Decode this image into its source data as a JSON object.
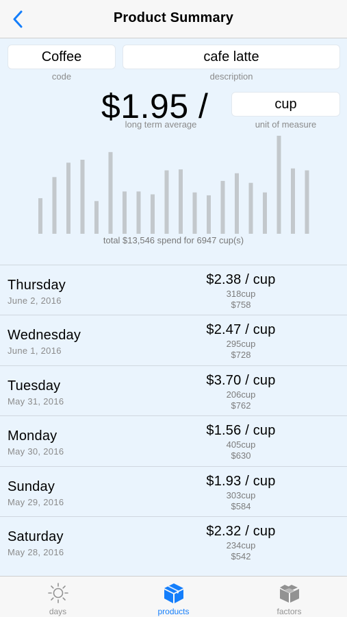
{
  "nav": {
    "title": "Product Summary"
  },
  "product": {
    "code": "Coffee",
    "code_caption": "code",
    "description": "cafe latte",
    "description_caption": "description",
    "price": "$1.95 /",
    "price_caption": "long term average",
    "unit": "cup",
    "unit_caption": "unit of measure"
  },
  "chart_data": {
    "type": "bar",
    "values": [
      3.7,
      5.9,
      7.4,
      7.7,
      3.4,
      8.5,
      4.4,
      4.4,
      4.1,
      6.6,
      6.7,
      4.3,
      4.0,
      5.5,
      6.3,
      5.3,
      4.3,
      10.2,
      6.8,
      6.6
    ],
    "color": "#c3c8cc",
    "total_label": "total $13,546 spend for 6947 cup(s)"
  },
  "days": [
    {
      "day": "Thursday",
      "date": "June 2, 2016",
      "rate": "$2.38 / cup",
      "qty": "318cup",
      "amount": "$758"
    },
    {
      "day": "Wednesday",
      "date": "June 1, 2016",
      "rate": "$2.47 / cup",
      "qty": "295cup",
      "amount": "$728"
    },
    {
      "day": "Tuesday",
      "date": "May 31, 2016",
      "rate": "$3.70 / cup",
      "qty": "206cup",
      "amount": "$762"
    },
    {
      "day": "Monday",
      "date": "May 30, 2016",
      "rate": "$1.56 / cup",
      "qty": "405cup",
      "amount": "$630"
    },
    {
      "day": "Sunday",
      "date": "May 29, 2016",
      "rate": "$1.93 / cup",
      "qty": "303cup",
      "amount": "$584"
    },
    {
      "day": "Saturday",
      "date": "May 28, 2016",
      "rate": "$2.32 / cup",
      "qty": "234cup",
      "amount": "$542"
    }
  ],
  "tabs": [
    {
      "label": "days",
      "icon": "sun-icon",
      "active": false
    },
    {
      "label": "products",
      "icon": "box-icon",
      "active": true
    },
    {
      "label": "factors",
      "icon": "boxes-icon",
      "active": false
    }
  ],
  "colors": {
    "accent": "#147efb",
    "background": "#eaf4fd",
    "bar": "#c3c8cc"
  }
}
